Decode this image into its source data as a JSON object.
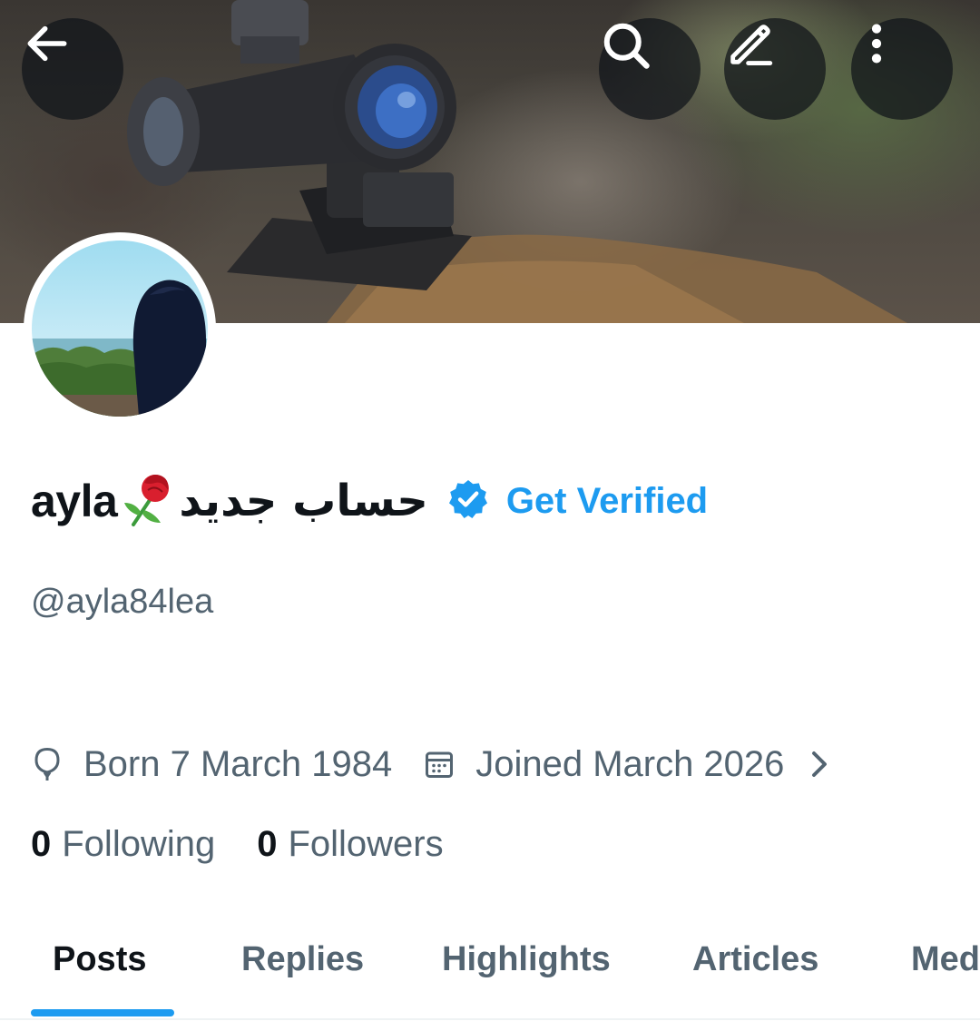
{
  "header": {
    "back_icon": "arrow-left-icon",
    "actions": [
      "search-icon",
      "edit-icon",
      "more-vertical-icon"
    ]
  },
  "profile": {
    "display_name": "ayla",
    "emoji": "🌹",
    "arabic_name": "حساب جديد",
    "get_verified_label": "Get Verified",
    "handle": "@ayla84lea",
    "born": "Born 7 March 1984",
    "joined": "Joined March 2026",
    "following_count": "0",
    "following_label": "Following",
    "followers_count": "0",
    "followers_label": "Followers"
  },
  "tabs": [
    {
      "label": "Posts",
      "active": true
    },
    {
      "label": "Replies",
      "active": false
    },
    {
      "label": "Highlights",
      "active": false
    },
    {
      "label": "Articles",
      "active": false
    },
    {
      "label": "Media",
      "active": false
    }
  ],
  "colors": {
    "accent": "#1d9bf0",
    "text_primary": "#0f1419",
    "text_secondary": "#536471"
  }
}
